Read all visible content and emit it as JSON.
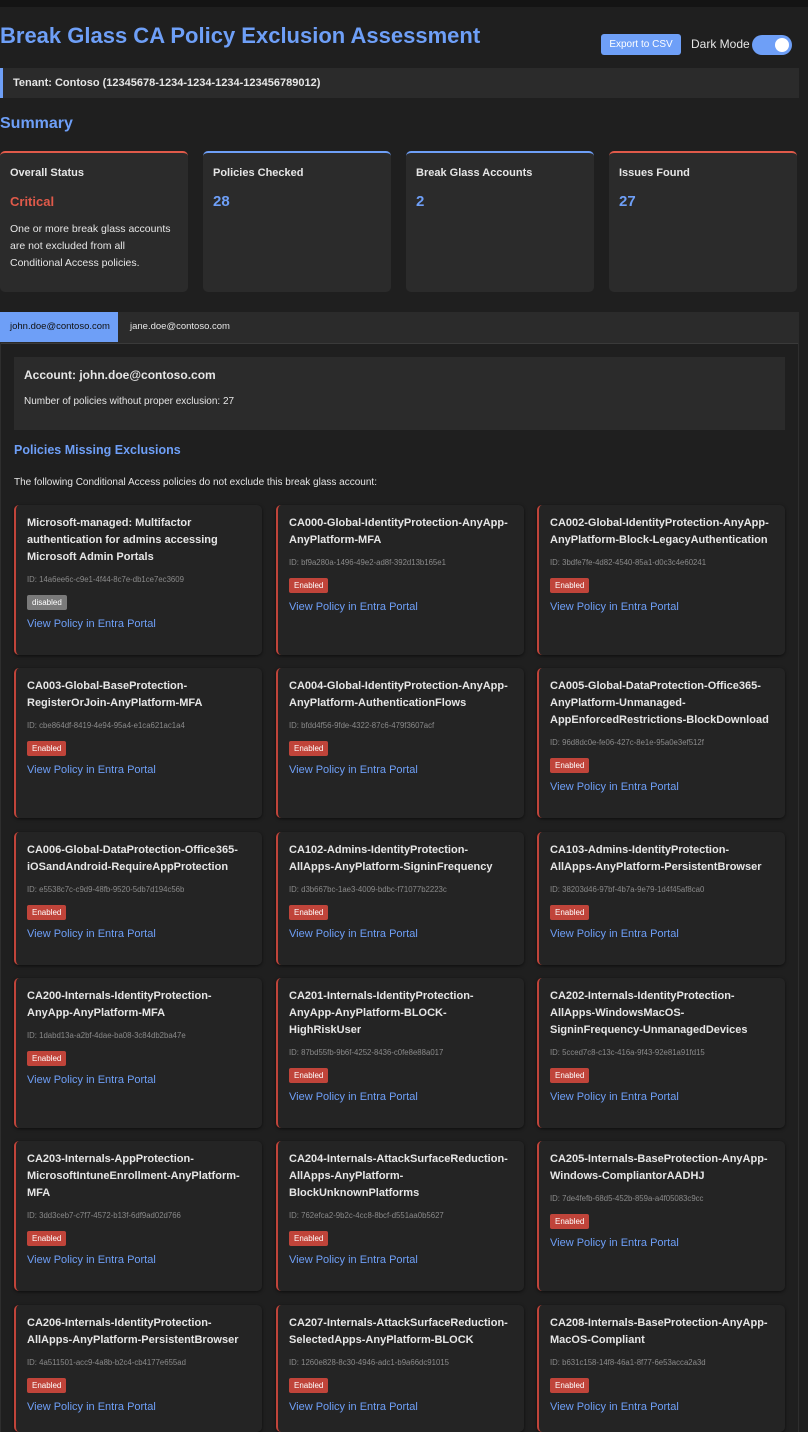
{
  "header": {
    "title": "Break Glass CA Policy Exclusion Assessment",
    "export_label": "Export to CSV",
    "dark_mode_label": "Dark Mode",
    "dark_mode_on": true
  },
  "tenant": {
    "text": "Tenant: Contoso (12345678-1234-1234-1234-123456789012)"
  },
  "summary": {
    "heading": "Summary",
    "overall_label": "Overall Status",
    "overall_value": "Critical",
    "overall_desc": "One or more break glass accounts are not excluded from all Conditional Access policies.",
    "policies_label": "Policies Checked",
    "policies_value": "28",
    "accounts_label": "Break Glass Accounts",
    "accounts_value": "2",
    "issues_label": "Issues Found",
    "issues_value": "27"
  },
  "tabs": [
    "john.doe@contoso.com",
    "jane.doe@contoso.com"
  ],
  "account": {
    "title": "Account: john.doe@contoso.com",
    "count_text": "Number of policies without proper exclusion: 27"
  },
  "missing": {
    "heading": "Policies Missing Exclusions",
    "description": "The following Conditional Access policies do not exclude this break glass account:",
    "link_label": "View Policy in Entra Portal"
  },
  "colors": {
    "accent": "#6e9ff7",
    "critical": "#e05a4a",
    "enabled_badge": "#c0443a",
    "disabled_badge": "#7a7a7a"
  },
  "policies": [
    {
      "name": "Microsoft-managed: Multifactor authentication for admins accessing Microsoft Admin Portals",
      "id": "ID: 14a6ee6c-c9e1-4f44-8c7e-db1ce7ec3609",
      "status": "disabled"
    },
    {
      "name": "CA000-Global-IdentityProtection-AnyApp-AnyPlatform-MFA",
      "id": "ID: bf9a280a-1496-49e2-ad8f-392d13b165e1",
      "status": "Enabled"
    },
    {
      "name": "CA002-Global-IdentityProtection-AnyApp-AnyPlatform-Block-LegacyAuthentication",
      "id": "ID: 3bdfe7fe-4d82-4540-85a1-d0c3c4e60241",
      "status": "Enabled"
    },
    {
      "name": "CA003-Global-BaseProtection-RegisterOrJoin-AnyPlatform-MFA",
      "id": "ID: cbe864df-8419-4e94-95a4-e1ca621ac1a4",
      "status": "Enabled"
    },
    {
      "name": "CA004-Global-IdentityProtection-AnyApp-AnyPlatform-AuthenticationFlows",
      "id": "ID: bfdd4f56-9fde-4322-87c6-479f3607acf",
      "status": "Enabled"
    },
    {
      "name": "CA005-Global-DataProtection-Office365-AnyPlatform-Unmanaged-AppEnforcedRestrictions-BlockDownload",
      "id": "ID: 96d8dc0e-fe06-427c-8e1e-95a0e3ef512f",
      "status": "Enabled"
    },
    {
      "name": "CA006-Global-DataProtection-Office365-iOSandAndroid-RequireAppProtection",
      "id": "ID: e5538c7c-c9d9-48fb-9520-5db7d194c56b",
      "status": "Enabled"
    },
    {
      "name": "CA102-Admins-IdentityProtection-AllApps-AnyPlatform-SigninFrequency",
      "id": "ID: d3b667bc-1ae3-4009-bdbc-f71077b2223c",
      "status": "Enabled"
    },
    {
      "name": "CA103-Admins-IdentityProtection-AllApps-AnyPlatform-PersistentBrowser",
      "id": "ID: 38203d46-97bf-4b7a-9e79-1d4f45af8ca0",
      "status": "Enabled"
    },
    {
      "name": "CA200-Internals-IdentityProtection-AnyApp-AnyPlatform-MFA",
      "id": "ID: 1dabd13a-a2bf-4dae-ba08-3c84db2ba47e",
      "status": "Enabled"
    },
    {
      "name": "CA201-Internals-IdentityProtection-AnyApp-AnyPlatform-BLOCK-HighRiskUser",
      "id": "ID: 87bd55fb-9b6f-4252-8436-c0fe8e88a017",
      "status": "Enabled"
    },
    {
      "name": "CA202-Internals-IdentityProtection-AllApps-WindowsMacOS-SigninFrequency-UnmanagedDevices",
      "id": "ID: 5cced7c8-c13c-416a-9f43-92e81a91fd15",
      "status": "Enabled"
    },
    {
      "name": "CA203-Internals-AppProtection-MicrosoftIntuneEnrollment-AnyPlatform-MFA",
      "id": "ID: 3dd3ceb7-c7f7-4572-b13f-6df9ad02d766",
      "status": "Enabled"
    },
    {
      "name": "CA204-Internals-AttackSurfaceReduction-AllApps-AnyPlatform-BlockUnknownPlatforms",
      "id": "ID: 762efca2-9b2c-4cc8-8bcf-d551aa0b5627",
      "status": "Enabled"
    },
    {
      "name": "CA205-Internals-BaseProtection-AnyApp-Windows-CompliantorAADHJ",
      "id": "ID: 7de4fefb-68d5-452b-859a-a4f05083c9cc",
      "status": "Enabled"
    },
    {
      "name": "CA206-Internals-IdentityProtection-AllApps-AnyPlatform-PersistentBrowser",
      "id": "ID: 4a511501-acc9-4a8b-b2c4-cb4177e655ad",
      "status": "Enabled"
    },
    {
      "name": "CA207-Internals-AttackSurfaceReduction-SelectedApps-AnyPlatform-BLOCK",
      "id": "ID: 1260e828-8c30-4946-adc1-b9a66dc91015",
      "status": "Enabled"
    },
    {
      "name": "CA208-Internals-BaseProtection-AnyApp-MacOS-Compliant",
      "id": "ID: b631c158-14f8-46a1-8f77-6e53acca2a3d",
      "status": "Enabled"
    }
  ]
}
